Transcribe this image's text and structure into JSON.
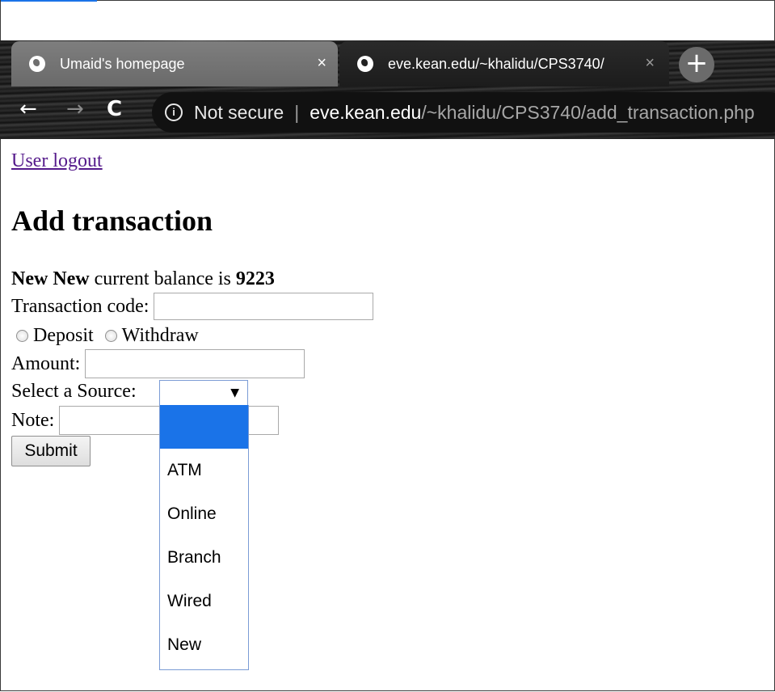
{
  "browser": {
    "tabs": [
      {
        "title": "Umaid's homepage",
        "close": "×"
      },
      {
        "title": "eve.kean.edu/~khalidu/CPS3740/",
        "close": "×"
      }
    ],
    "new_tab": "+",
    "nav": {
      "back": "←",
      "forward": "→",
      "reload": "C"
    },
    "omnibox": {
      "security_icon": "info-icon",
      "security_label": "Not secure",
      "separator": "|",
      "host": "eve.kean.edu",
      "path": "/~khalidu/CPS3740/add_transaction.php"
    }
  },
  "page": {
    "logout_link": "User logout",
    "heading": "Add transaction",
    "balance": {
      "name": "New New",
      "text": " current balance is ",
      "amount": "9223"
    },
    "form": {
      "transaction_code_label": "Transaction code:",
      "transaction_code_value": "",
      "deposit_label": "Deposit",
      "withdraw_label": "Withdraw",
      "amount_label": "Amount:",
      "amount_value": "",
      "source_label": "Select a Source:",
      "source_selected": "",
      "source_options": [
        "",
        "ATM",
        "Online",
        "Branch",
        "Wired",
        "New"
      ],
      "note_label": "Note:",
      "note_value": "",
      "submit_label": "Submit"
    }
  },
  "colors": {
    "link_visited": "#551a8b",
    "select_highlight": "#1a73e8",
    "select_border": "#7a9bd5"
  }
}
